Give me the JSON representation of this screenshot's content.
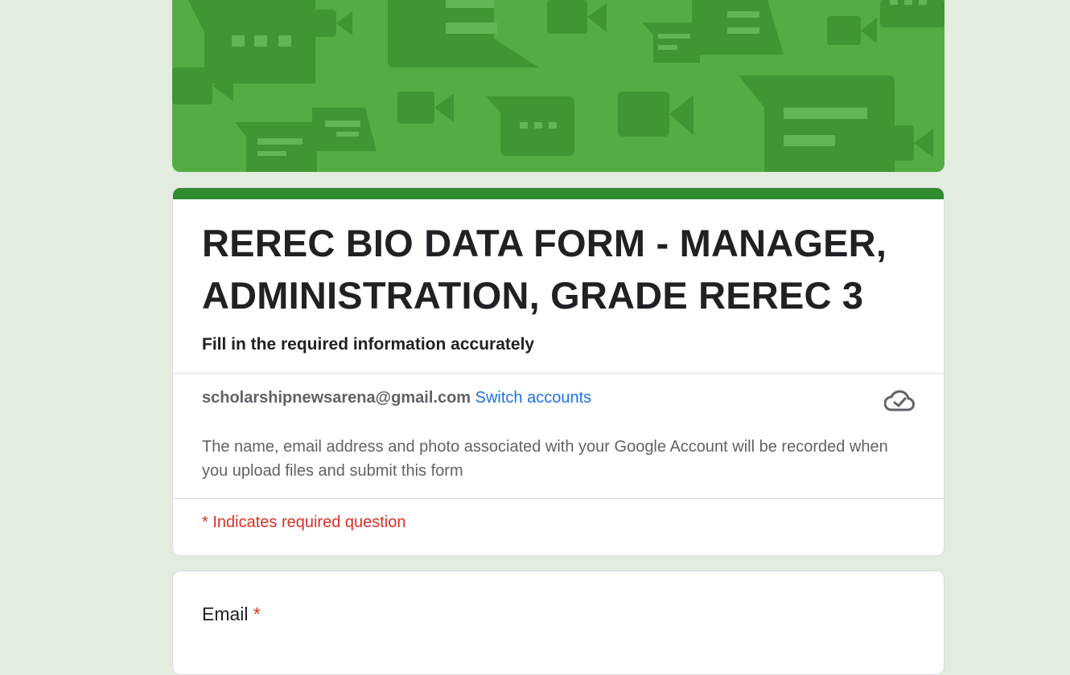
{
  "form": {
    "title": "REREC BIO DATA FORM - MANAGER, ADMINISTRATION, GRADE REREC 3",
    "description": "Fill in the required information accurately"
  },
  "account": {
    "email": "scholarshipnewsarena@gmail.com",
    "switch_label": "Switch accounts",
    "cloud_icon": "cloud-check-icon",
    "privacy_note": "The name, email address and photo associated with your Google Account will be recorded when you upload files and submit this form"
  },
  "required_note": "* Indicates required question",
  "questions": [
    {
      "label": "Email",
      "required_mark": "*"
    }
  ],
  "colors": {
    "page_bg": "#e2ede0",
    "banner_green": "#54ac45",
    "accent_green": "#2e8b2e",
    "link_blue": "#1a73e8",
    "required_red": "#d93025"
  }
}
